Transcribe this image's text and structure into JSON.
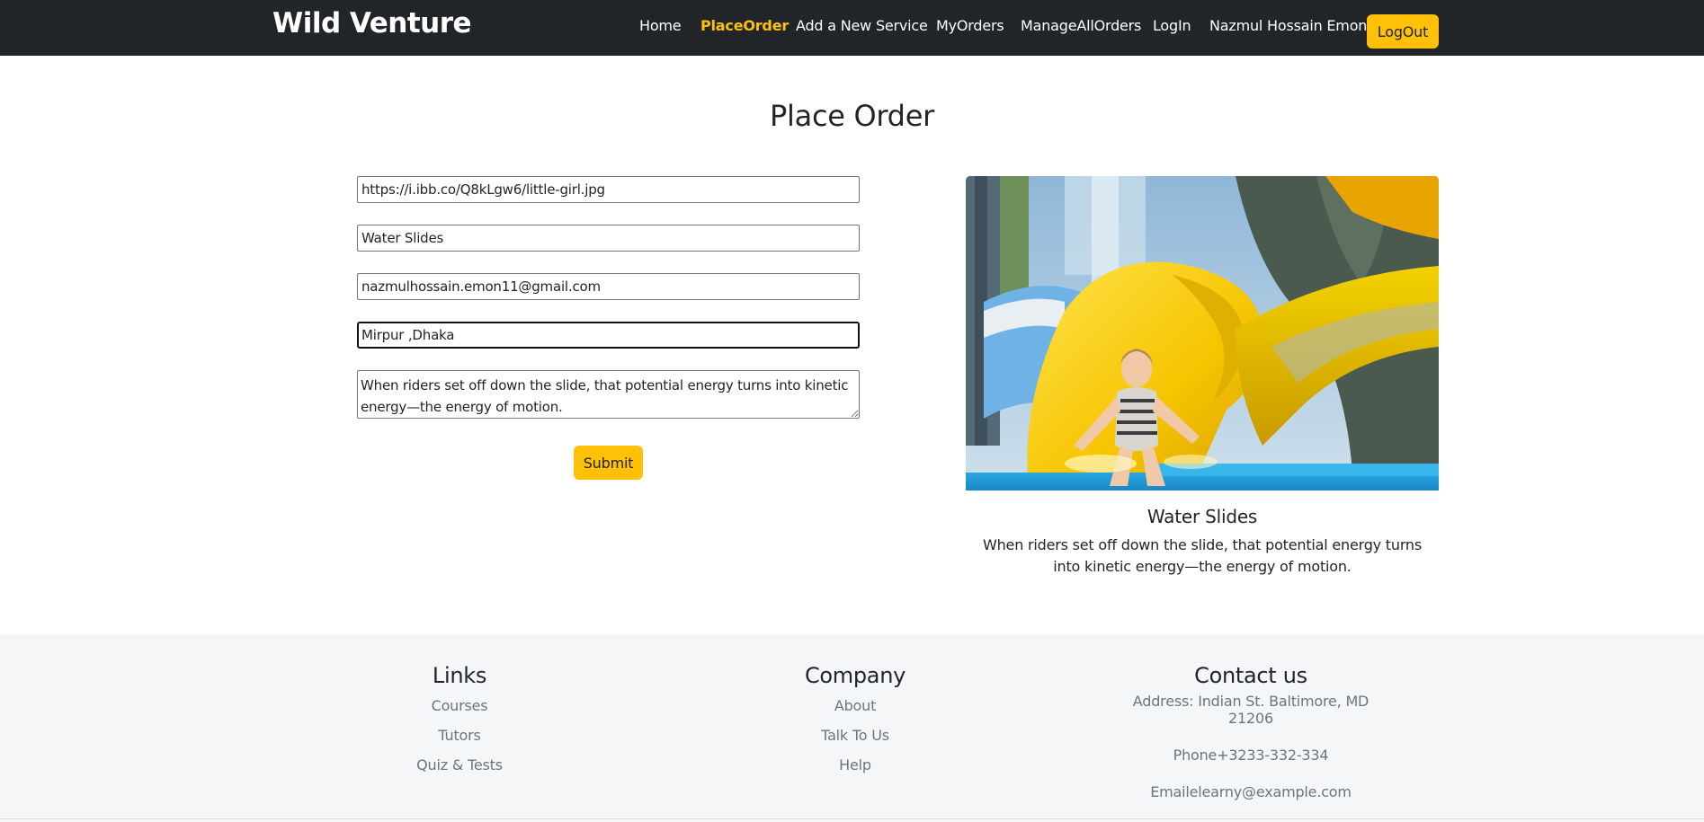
{
  "navbar": {
    "brand": "Wild Venture",
    "links": [
      {
        "label": "Home",
        "active": false
      },
      {
        "label": "PlaceOrder",
        "active": true
      },
      {
        "label": "Add a New Service",
        "active": false
      },
      {
        "label": "MyOrders",
        "active": false
      },
      {
        "label": "ManageAllOrders",
        "active": false
      },
      {
        "label": "LogIn",
        "active": false
      },
      {
        "label": "Nazmul Hossain Emon",
        "active": false
      }
    ],
    "logout_label": "LogOut"
  },
  "page": {
    "title": "Place Order"
  },
  "form": {
    "image_url": "https://i.ibb.co/Q8kLgw6/little-girl.jpg",
    "service_name": "Water Slides",
    "email": "nazmulhossain.emon11@gmail.com",
    "address": "Mirpur ,Dhaka",
    "description": "When riders set off down the slide, that potential energy turns into kinetic energy—the energy of motion.",
    "submit_label": "Submit"
  },
  "service_card": {
    "title": "Water Slides",
    "description": "When riders set off down the slide, that potential energy turns into kinetic energy—the energy of motion."
  },
  "footer": {
    "links": {
      "heading": "Links",
      "items": [
        "Courses",
        "Tutors",
        "Quiz & Tests"
      ]
    },
    "company": {
      "heading": "Company",
      "items": [
        "About",
        "Talk To Us",
        "Help"
      ]
    },
    "contact": {
      "heading": "Contact us",
      "address": "Address: Indian St. Baltimore, MD 21206",
      "phone": "Phone+3233-332-334",
      "email": "Emailelearny@example.com"
    }
  },
  "colors": {
    "navbar_bg": "#212529",
    "accent": "#ffc107",
    "footer_bg": "#f5f6f8",
    "muted_text": "#6c757d"
  }
}
